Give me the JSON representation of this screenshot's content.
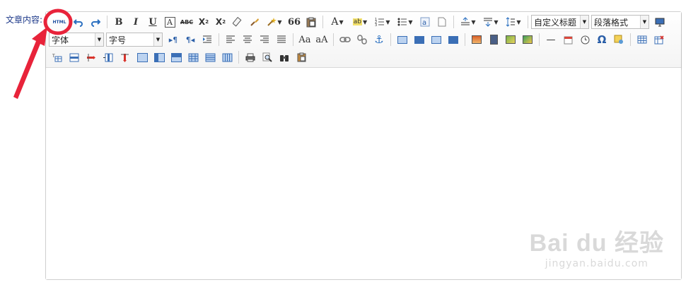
{
  "field_label": "文章内容:",
  "toolbar": {
    "html_label": "HTML",
    "bold": "B",
    "italic": "I",
    "underline": "U",
    "fontborder": "A",
    "strike": "ABC",
    "superscript": "X",
    "superscript_mark": "2",
    "subscript": "X",
    "subscript_mark": "2",
    "quote": "66",
    "forecolor": "A",
    "backcolor": "ab",
    "custom_heading": "自定义标题",
    "paragraph_format": "段落格式",
    "font_family": "字体",
    "font_size": "字号",
    "omega": "Ω",
    "dash": "—"
  },
  "watermark": {
    "brand": "Bai du 经验",
    "url": "jingyan.baidu.com"
  },
  "colors": {
    "accent": "#1e4fa0",
    "annotation": "#e8233a"
  }
}
